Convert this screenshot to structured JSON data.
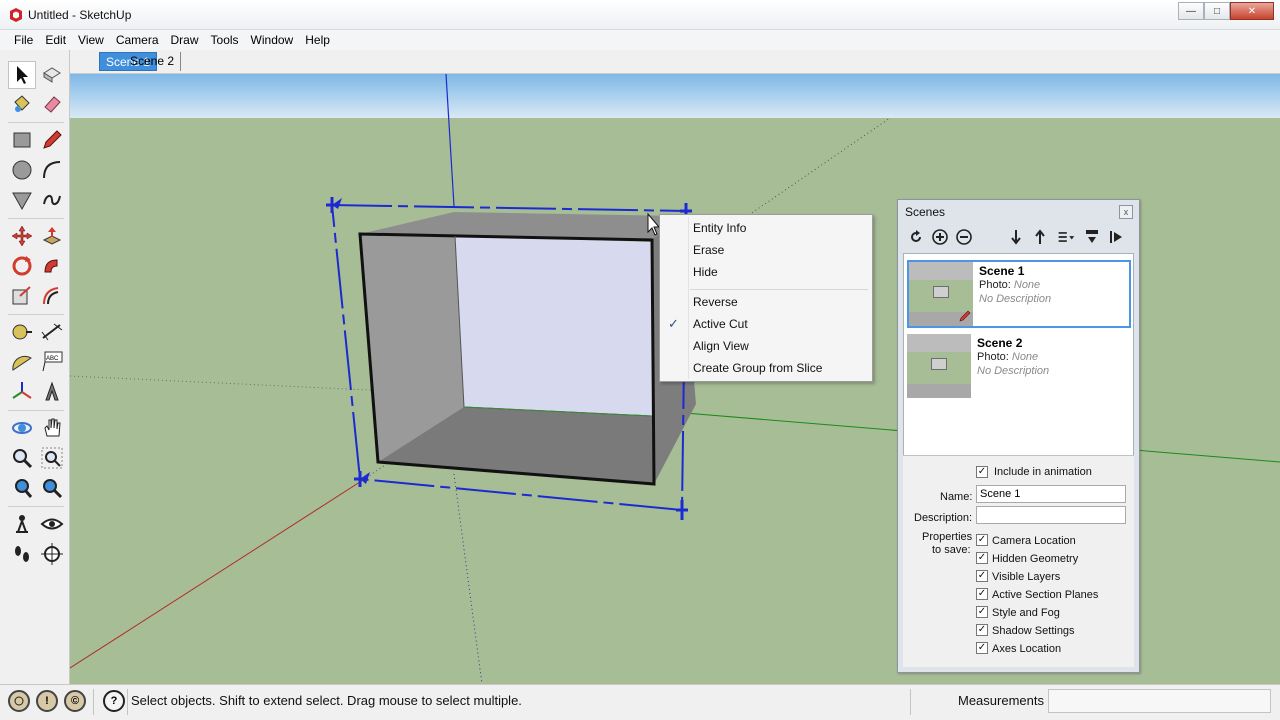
{
  "window": {
    "title": "Untitled - SketchUp",
    "controls": [
      "minimize-icon",
      "maximize-icon",
      "close-icon"
    ]
  },
  "menubar": {
    "items": [
      "File",
      "Edit",
      "View",
      "Camera",
      "Draw",
      "Tools",
      "Window",
      "Help"
    ]
  },
  "scene_tabs": [
    {
      "label": "Scene 1",
      "active": true
    },
    {
      "label": "Scene 2",
      "active": false
    }
  ],
  "toolbar": {
    "tools": [
      "select-icon",
      "make-component-icon",
      "paint-bucket-icon",
      "eraser-icon",
      "rectangle-icon",
      "pencil-icon",
      "circle-icon",
      "arc-icon",
      "polygon-icon",
      "freehand-icon",
      "move-icon",
      "push-pull-icon",
      "rotate-icon",
      "follow-me-icon",
      "scale-icon",
      "offset-icon",
      "tape-measure-icon",
      "dimension-icon",
      "protractor-icon",
      "text-icon",
      "axes-icon",
      "3d-text-icon",
      "orbit-icon",
      "pan-icon",
      "zoom-icon",
      "zoom-window-icon",
      "previous-view-icon",
      "zoom-extents-icon",
      "position-camera-icon",
      "look-around-icon",
      "walk-icon",
      "section-plane-icon"
    ]
  },
  "context_menu": {
    "items": [
      {
        "label": "Entity Info",
        "checked": false
      },
      {
        "label": "Erase",
        "checked": false
      },
      {
        "label": "Hide",
        "checked": false
      },
      {
        "label": "Reverse",
        "checked": false
      },
      {
        "label": "Active Cut",
        "checked": true
      },
      {
        "label": "Align View",
        "checked": false
      },
      {
        "label": "Create Group from Slice",
        "checked": false
      }
    ],
    "check_mark": "✓"
  },
  "scenes_panel": {
    "title": "Scenes",
    "close_label": "x",
    "toolbar_icons": [
      "update-scene-icon",
      "add-scene-icon",
      "remove-scene-icon",
      "move-down-icon",
      "move-up-icon",
      "view-options-icon",
      "toggle-details-icon",
      "expand-icon"
    ],
    "scenes": [
      {
        "name": "Scene 1",
        "photo_label": "Photo:",
        "photo_value": "None",
        "description": "No Description",
        "selected": true
      },
      {
        "name": "Scene 2",
        "photo_label": "Photo:",
        "photo_value": "None",
        "description": "No Description",
        "selected": false
      }
    ],
    "include_in_animation": {
      "label": "Include in animation",
      "checked": true
    },
    "name_label": "Name:",
    "name_value": "Scene 1",
    "description_label": "Description:",
    "description_value": "",
    "properties_label_1": "Properties",
    "properties_label_2": "to save:",
    "properties": [
      {
        "label": "Camera Location",
        "checked": true
      },
      {
        "label": "Hidden Geometry",
        "checked": true
      },
      {
        "label": "Visible Layers",
        "checked": true
      },
      {
        "label": "Active Section Planes",
        "checked": true
      },
      {
        "label": "Style and Fog",
        "checked": true
      },
      {
        "label": "Shadow Settings",
        "checked": true
      },
      {
        "label": "Axes Location",
        "checked": true
      }
    ]
  },
  "statusbar": {
    "icons": [
      "geo-location-icon",
      "credits-icon",
      "copyright-icon",
      "help-icon"
    ],
    "help_glyph": "?",
    "credits_glyph": "!",
    "copyright_glyph": "©",
    "message": "Select objects. Shift to extend select. Drag mouse to select multiple.",
    "measurements_label": "Measurements",
    "measurements_value": ""
  },
  "colors": {
    "sky": "#8fc3ea",
    "ground": "#a7bd96",
    "section_plane": "#1b2bd1",
    "box_outer": "#7a7a7a",
    "box_inner_face": "#d6d9ec",
    "tab_active": "#3f8fdc"
  }
}
